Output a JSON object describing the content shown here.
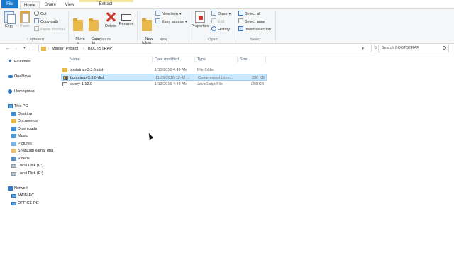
{
  "tabs": {
    "file": "File",
    "home": "Home",
    "share": "Share",
    "view": "View",
    "extract": "Extract"
  },
  "ribbon": {
    "clipboard": {
      "copy": "Copy",
      "paste": "Paste",
      "cut": "Cut",
      "copy_path": "Copy path",
      "paste_shortcut": "Paste shortcut",
      "label": "Clipboard"
    },
    "organize": {
      "move_to": "Move\nto",
      "copy_to": "Copy\nto",
      "delete": "Delete",
      "rename": "Rename",
      "label": "Organize"
    },
    "new": {
      "new_folder": "New\nfolder",
      "new_item": "New item",
      "easy_access": "Easy access",
      "label": "New"
    },
    "open": {
      "properties": "Properties",
      "open": "Open",
      "edit": "Edit",
      "history": "History",
      "label": "Open"
    },
    "select": {
      "select_all": "Select all",
      "select_none": "Select none",
      "invert_selection": "Invert selection",
      "label": "Select"
    }
  },
  "address": {
    "crumbs": [
      "Master_Project",
      "BOOTSTRAP"
    ],
    "search_placeholder": "Search BOOTSTRAP"
  },
  "nav": {
    "favorites": "Favorites",
    "onedrive": "OneDrive",
    "homegroup": "Homegroup",
    "this_pc": "This PC",
    "pc_items": [
      "Desktop",
      "Documents",
      "Downloads",
      "Music",
      "Pictures",
      "Shahzaib kamal (ma",
      "Videos",
      "Local Disk (C:)",
      "Local Disk (E:)"
    ],
    "network": "Network",
    "network_items": [
      "MAIN-PC",
      "OFFICE-PC"
    ]
  },
  "columns": {
    "name": "Name",
    "date": "Date modified",
    "type": "Type",
    "size": "Size"
  },
  "files": [
    {
      "name": "bootstrap-3.3.6-dist",
      "date": "1/13/2016 4:49 AM",
      "type": "File folder",
      "size": "",
      "kind": "folder",
      "selected": false
    },
    {
      "name": "bootstrap-3.3.6-dist",
      "date": "11/25/2015 12:42 ...",
      "type": "Compressed (zipp...",
      "size": "280 KB",
      "kind": "zip",
      "selected": true
    },
    {
      "name": "jquery-1.12.0",
      "date": "1/13/2016 4:48 AM",
      "type": "JavaScript File",
      "size": "288 KB",
      "kind": "js",
      "selected": false
    }
  ],
  "colors": {
    "file_tab": "#1979ca",
    "selection": "#cce8ff",
    "selection_border": "#99d1ff",
    "contextual_tab": "#f1e29c"
  }
}
